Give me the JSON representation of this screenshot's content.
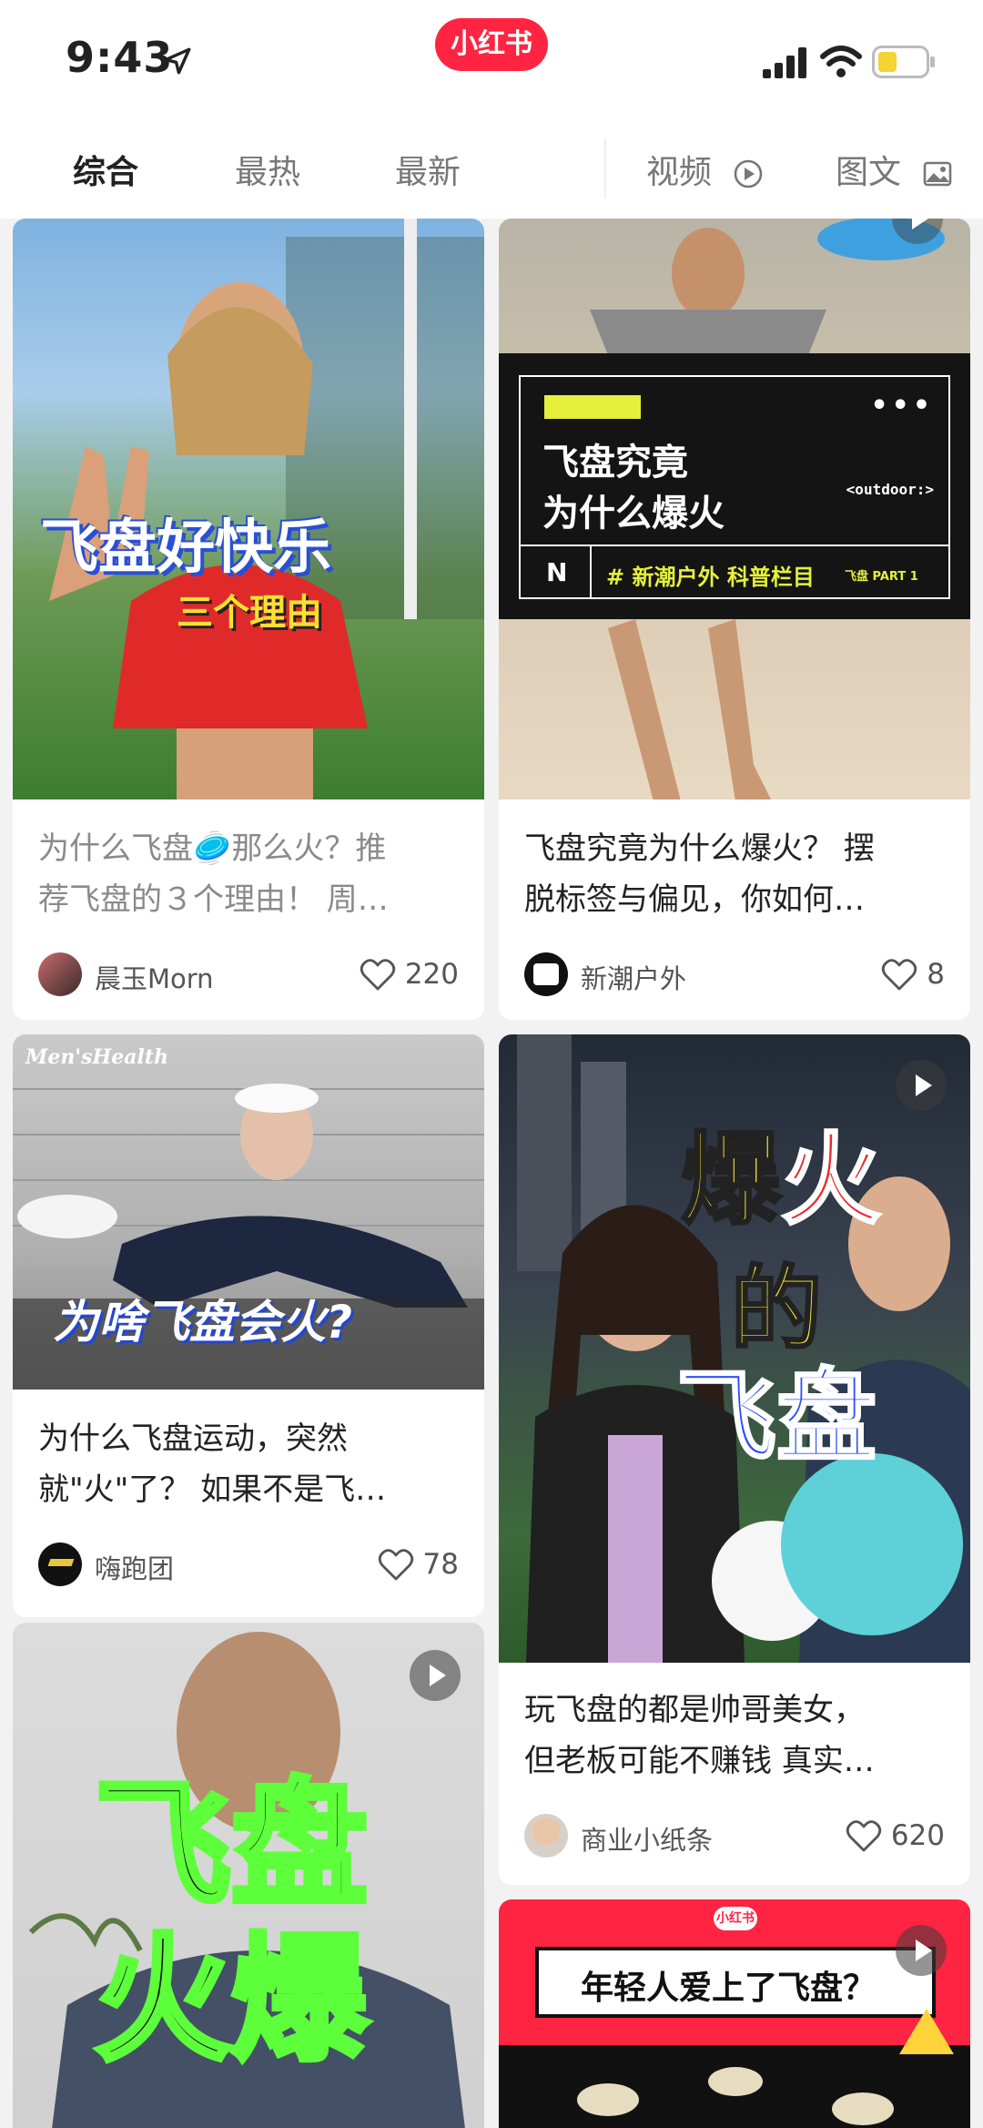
{
  "status_bar": {
    "time": "9:43"
  },
  "app": {
    "logo_text": "小红书"
  },
  "tabs": [
    {
      "label": "综合"
    },
    {
      "label": "最热"
    },
    {
      "label": "最新"
    },
    {
      "label": "视频"
    },
    {
      "label": "图文"
    }
  ],
  "cards": [
    {
      "overlay_title": "飞盘好快乐",
      "overlay_subtitle": "三个理由",
      "title_line1": "为什么飞盘🥏那么火？推",
      "title_line2": "荐飞盘的３个理由！ 周…",
      "author": "晨玉Morn",
      "likes": "220"
    },
    {
      "overlay_title_line1": "飞盘究竟",
      "overlay_title_line2": "为什么爆火",
      "overlay_tag": "<outdoor:>",
      "overlay_logo": "N",
      "overlay_hashtag": "# 新潮户外 科普栏目",
      "overlay_part": "飞盘 PART 1",
      "title_line1": "飞盘究竟为什么爆火？ 摆",
      "title_line2": "脱标签与偏见，你如何…",
      "author": "新潮户外",
      "likes": "8"
    },
    {
      "overlay_brand": "Men'sHealth",
      "overlay_title": "为啥飞盘会火?",
      "title_line1": "为什么飞盘运动，突然",
      "title_line2": "就\"火\"了？ 如果不是飞…",
      "author": "嗨跑团",
      "likes": "78"
    },
    {
      "overlay_line1a": "爆",
      "overlay_line1b": "火",
      "overlay_line2": "的",
      "overlay_line3": "飞盘",
      "title_line1": "玩飞盘的都是帅哥美女，",
      "title_line2": "但老板可能不赚钱 真实…",
      "author": "商业小纸条",
      "likes": "620"
    },
    {
      "overlay_line1": "飞盘",
      "overlay_line2": "火爆"
    },
    {
      "overlay_badge": "小红书",
      "overlay_title": "年轻人爱上了飞盘？"
    }
  ],
  "colors": {
    "brand": "#ff2442",
    "battery": "#f5d330"
  }
}
